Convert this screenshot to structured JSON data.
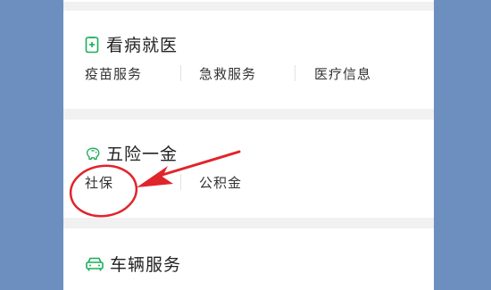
{
  "sections": {
    "health": {
      "title": "看病就医",
      "icon": "medical-kit-icon",
      "items": [
        "疫苗服务",
        "急救服务",
        "医疗信息"
      ]
    },
    "insurance": {
      "title": "五险一金",
      "icon": "piggy-bank-icon",
      "items": [
        "社保",
        "公积金"
      ]
    },
    "vehicle": {
      "title": "车辆服务",
      "icon": "car-icon"
    }
  },
  "colors": {
    "accent_green": "#1aad5a",
    "annotation_red": "#e0252b",
    "backdrop": "#6c8fc0"
  }
}
